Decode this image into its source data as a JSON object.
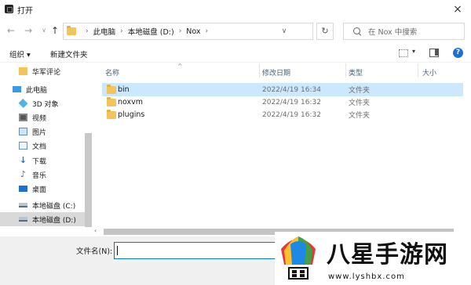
{
  "window": {
    "title": "打开",
    "close_icon": "×"
  },
  "nav": {
    "back": "←",
    "forward": "→",
    "dropdown": "∨",
    "up": "↑",
    "breadcrumb": [
      "此电脑",
      "本地磁盘 (D:)",
      "Nox"
    ],
    "refresh": "↻",
    "search_placeholder": "在 Nox 中搜索"
  },
  "toolbar": {
    "organize": "组织 ▾",
    "new_folder": "新建文件夹",
    "view_dropdown": "▾",
    "help": "?"
  },
  "sidebar": {
    "items": [
      {
        "label": "华军评论",
        "icon": "folder-icon"
      },
      {
        "label": "此电脑",
        "icon": "computer-icon"
      },
      {
        "label": "3D 对象",
        "icon": "cube-icon"
      },
      {
        "label": "视频",
        "icon": "video-icon"
      },
      {
        "label": "图片",
        "icon": "picture-icon"
      },
      {
        "label": "文档",
        "icon": "document-icon"
      },
      {
        "label": "下载",
        "icon": "download-icon"
      },
      {
        "label": "音乐",
        "icon": "music-icon"
      },
      {
        "label": "桌面",
        "icon": "desktop-icon"
      },
      {
        "label": "本地磁盘 (C:)",
        "icon": "drive-icon"
      },
      {
        "label": "本地磁盘 (D:)",
        "icon": "drive-icon"
      }
    ]
  },
  "columns": {
    "name": "名称",
    "date": "修改日期",
    "type": "类型",
    "size": "大小"
  },
  "files": [
    {
      "name": "bin",
      "date": "2022/4/19 16:34",
      "type": "文件夹"
    },
    {
      "name": "noxvm",
      "date": "2022/4/19 16:32",
      "type": "文件夹"
    },
    {
      "name": "plugins",
      "date": "2022/4/19 16:32",
      "type": "文件夹"
    }
  ],
  "footer": {
    "filename_label": "文件名(N):",
    "filename_value": ""
  },
  "watermark": {
    "text": "八星手游网",
    "url": "www.lyshbx.com"
  },
  "colors": {
    "selection": "#cce8ff",
    "accent": "#0078d7",
    "folder": "#f2c55c"
  }
}
